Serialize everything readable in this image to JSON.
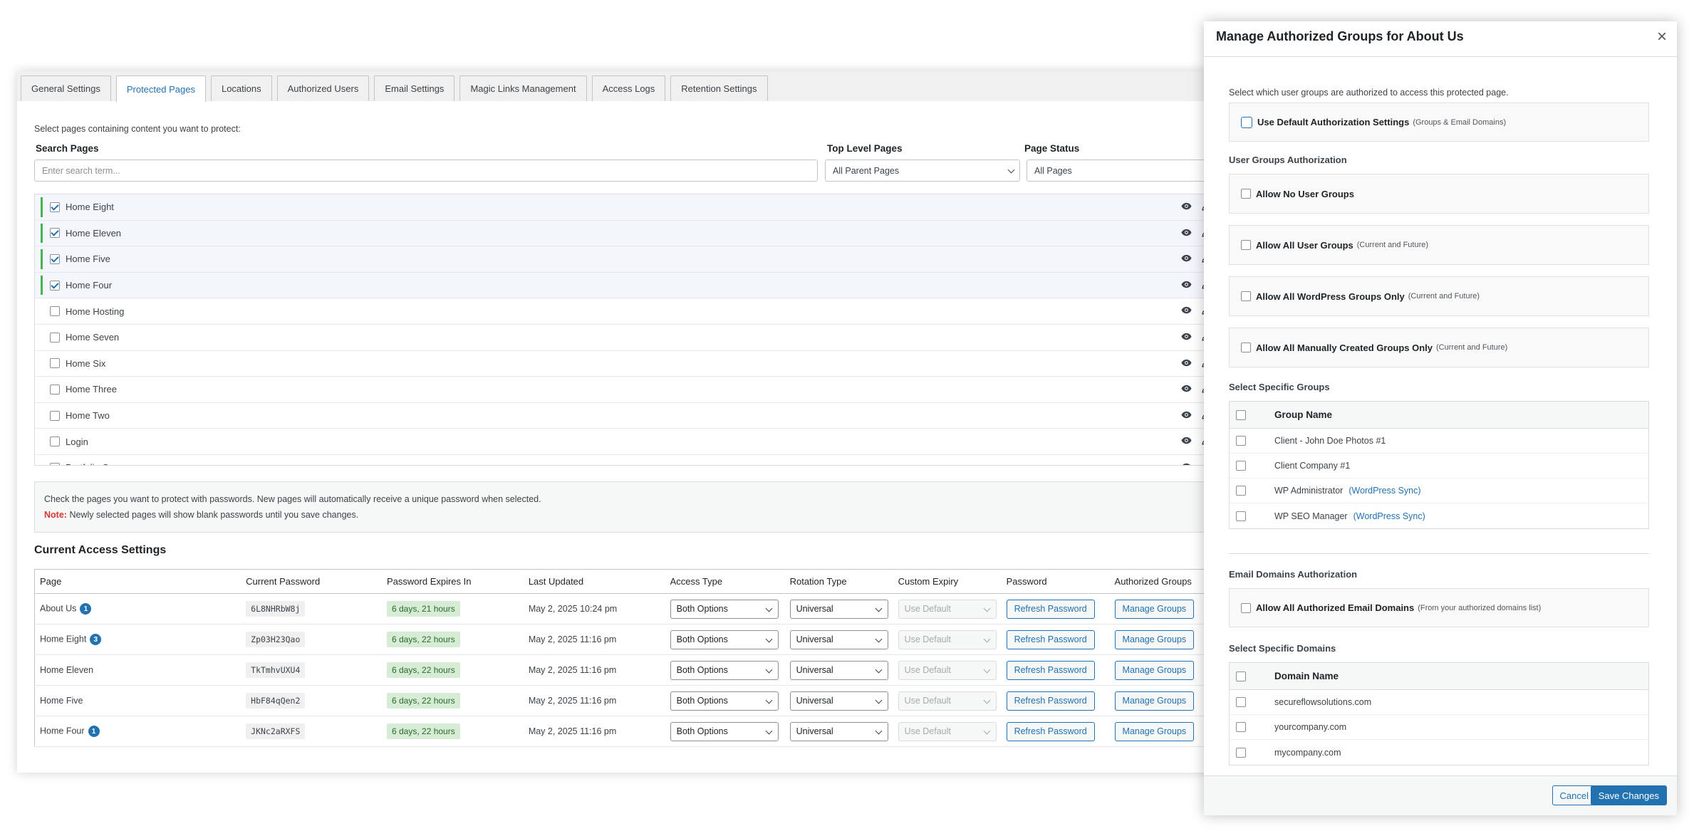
{
  "tabs": [
    "General Settings",
    "Protected Pages",
    "Locations",
    "Authorized Users",
    "Email Settings",
    "Magic Links Management",
    "Access Logs",
    "Retention Settings"
  ],
  "protected": {
    "intro": "Select pages containing content you want to protect:",
    "search_label": "Search Pages",
    "search_placeholder": "Enter search term...",
    "top_level_label": "Top Level Pages",
    "top_level_value": "All Parent Pages",
    "status_label": "Page Status",
    "status_value": "All Pages",
    "pages": [
      {
        "name": "Home Eight",
        "checked": true
      },
      {
        "name": "Home Eleven",
        "checked": true
      },
      {
        "name": "Home Five",
        "checked": true
      },
      {
        "name": "Home Four",
        "checked": true
      },
      {
        "name": "Home Hosting",
        "checked": false
      },
      {
        "name": "Home Seven",
        "checked": false
      },
      {
        "name": "Home Six",
        "checked": false
      },
      {
        "name": "Home Three",
        "checked": false
      },
      {
        "name": "Home Two",
        "checked": false
      },
      {
        "name": "Login",
        "checked": false
      },
      {
        "name": "Portfolio One",
        "checked": false
      }
    ],
    "notice_line1": "Check the pages you want to protect with passwords. New pages will automatically receive a unique password when selected.",
    "notice_label": "Note:",
    "notice_line2": "Newly selected pages will show blank passwords until you save changes."
  },
  "access": {
    "title": "Current Access Settings",
    "columns": [
      "Page",
      "Current Password",
      "Password Expires In",
      "Last Updated",
      "Access Type",
      "Rotation Type",
      "Custom Expiry",
      "Password",
      "Authorized Groups"
    ],
    "refresh_label": "Refresh Password",
    "manage_label": "Manage Groups",
    "rows": [
      {
        "page": "About Us",
        "badge": "1",
        "password": "6L8NHRbW8j",
        "expires": "6 days, 21 hours",
        "updated": "May 2, 2025 10:24 pm",
        "access": "Both Options",
        "rotation": "Universal",
        "expiry": "Use Default"
      },
      {
        "page": "Home Eight",
        "badge": "3",
        "password": "Zp03H23Qao",
        "expires": "6 days, 22 hours",
        "updated": "May 2, 2025 11:16 pm",
        "access": "Both Options",
        "rotation": "Universal",
        "expiry": "Use Default"
      },
      {
        "page": "Home Eleven",
        "badge": "",
        "password": "TkTmhvUXU4",
        "expires": "6 days, 22 hours",
        "updated": "May 2, 2025 11:16 pm",
        "access": "Both Options",
        "rotation": "Universal",
        "expiry": "Use Default"
      },
      {
        "page": "Home Five",
        "badge": "",
        "password": "HbF84qQen2",
        "expires": "6 days, 22 hours",
        "updated": "May 2, 2025 11:16 pm",
        "access": "Both Options",
        "rotation": "Universal",
        "expiry": "Use Default"
      },
      {
        "page": "Home Four",
        "badge": "1",
        "password": "JKNc2aRXFS",
        "expires": "6 days, 22 hours",
        "updated": "May 2, 2025 11:16 pm",
        "access": "Both Options",
        "rotation": "Universal",
        "expiry": "Use Default"
      }
    ]
  },
  "modal": {
    "title": "Manage Authorized Groups for About Us",
    "close_glyph": "×",
    "intro": "Select which user groups are authorized to access this protected page.",
    "default_label": "Use Default Authorization Settings",
    "default_sub": "(Groups & Email Domains)",
    "user_groups_title": "User Groups Authorization",
    "options": [
      {
        "label": "Allow No User Groups",
        "sub": ""
      },
      {
        "label": "Allow All User Groups",
        "sub": "(Current and Future)"
      },
      {
        "label": "Allow All WordPress Groups Only",
        "sub": "(Current and Future)"
      },
      {
        "label": "Allow All Manually Created Groups Only",
        "sub": "(Current and Future)"
      }
    ],
    "specific_groups_title": "Select Specific Groups",
    "group_header": "Group Name",
    "groups": [
      {
        "name": "Client - John Doe Photos #1",
        "sync": ""
      },
      {
        "name": "Client Company #1",
        "sync": ""
      },
      {
        "name": "WP Administrator",
        "sync": "(WordPress Sync)"
      },
      {
        "name": "WP SEO Manager",
        "sync": "(WordPress Sync)"
      }
    ],
    "email_title": "Email Domains Authorization",
    "email_all_label": "Allow All Authorized Email Domains",
    "email_all_sub": "(From your authorized domains list)",
    "specific_domains_title": "Select Specific Domains",
    "domain_header": "Domain Name",
    "domains": [
      "secureflowsolutions.com",
      "yourcompany.com",
      "mycompany.com"
    ],
    "cancel_label": "Cancel",
    "save_label": "Save Changes"
  },
  "colors": {
    "accent": "#2271b1",
    "checked_bar": "#46b450",
    "expires_bg": "#d7ecd5",
    "note": "#d63638"
  }
}
